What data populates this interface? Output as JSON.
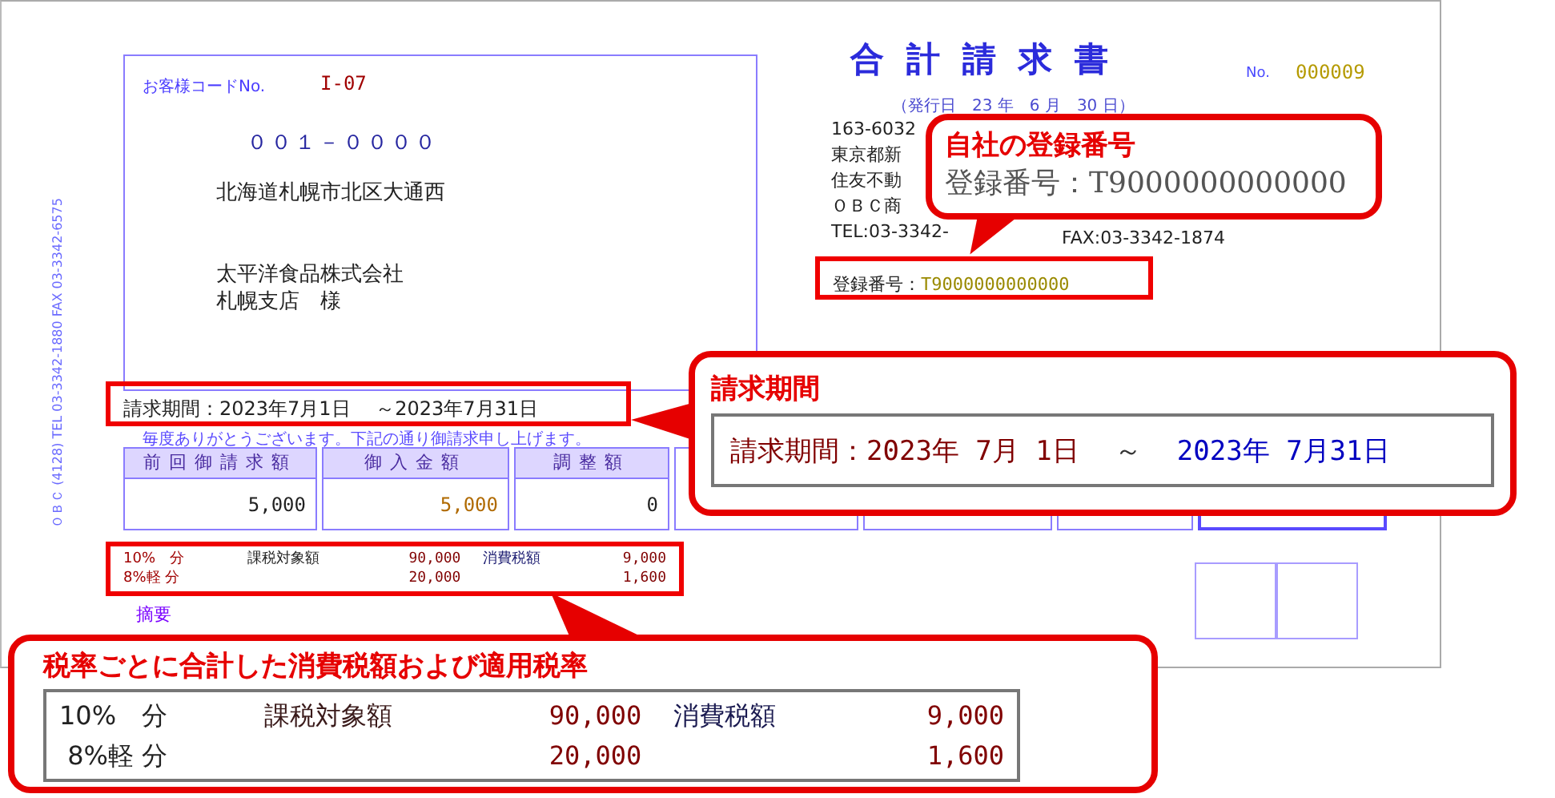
{
  "document": {
    "title": "合計請求書",
    "number_label": "No.",
    "number": "000009",
    "issue_date": "（発行日　23 年　6 月　30 日）",
    "customer_code_label": "お客様コードNo.",
    "customer_code": "I-07",
    "postal_code": "００１－００００",
    "address": "北海道札幌市北区大通西",
    "company": "太平洋食品株式会社",
    "branch": "札幌支店　様",
    "sender_lines": [
      "163-6032",
      "東京都新",
      "住友不動",
      "ＯＢＣ商",
      "TEL:03-3342-"
    ],
    "sender_fax": "FAX:03-3342-1874",
    "registration": {
      "label": "登録番号：",
      "value": "T9000000000000"
    },
    "side_text": "ＯＢＣ (4128) TEL 03-3342-1880 FAX 03-3342-6575",
    "billing_period": "請求期間：2023年7月1日　 ～2023年7月31日",
    "greeting": "毎度ありがとうございます。下記の通り御請求申し上げます。",
    "summary": [
      {
        "label": "前回御請求額",
        "value": "5,000"
      },
      {
        "label": "御入金額",
        "value": "5,000"
      },
      {
        "label": "調整額",
        "value": "0"
      }
    ],
    "tax_rows": [
      {
        "rate": "10%　分",
        "base_label": "課税対象額",
        "base": "90,000",
        "tax_label": "消費税額",
        "tax": "9,000"
      },
      {
        "rate": "8%軽 分",
        "base": "20,000",
        "tax": "1,600"
      }
    ],
    "memo_label": "摘要"
  },
  "callouts": {
    "registration": {
      "title": "自社の登録番号",
      "text": "登録番号：T9000000000000"
    },
    "period": {
      "title": "請求期間",
      "start": "請求期間：2023年 7月 1日",
      "separator": "～",
      "end": "2023年 7月31日"
    },
    "tax": {
      "title": "税率ごとに合計した消費税額および適用税率",
      "rows": [
        {
          "rate": "10%　分",
          "base_label": "課税対象額",
          "base": "90,000",
          "tax_label": "消費税額",
          "tax": "9,000"
        },
        {
          "rate": " 8%軽 分",
          "base": "20,000",
          "tax": "1,600"
        }
      ]
    }
  }
}
